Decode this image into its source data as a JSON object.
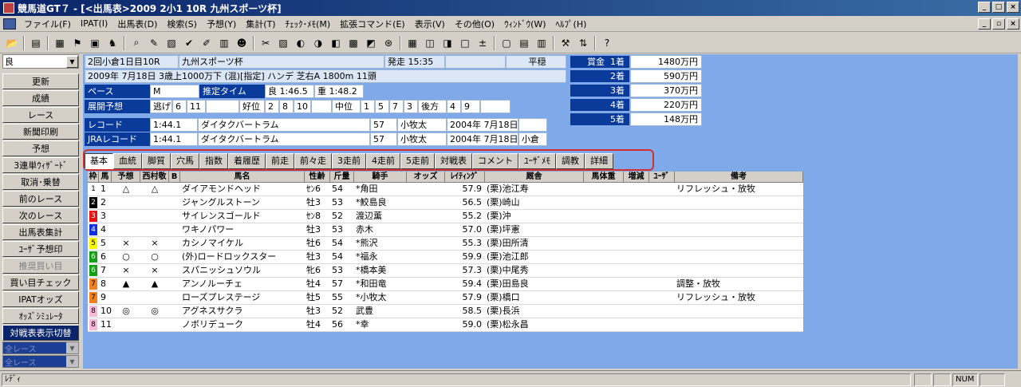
{
  "title": "競馬道GT７ - [<出馬表>2009 2小1 10R 九州スポーツ杯]",
  "menu": [
    "ファイル(F)",
    "IPAT(I)",
    "出馬表(D)",
    "検索(S)",
    "予想(Y)",
    "集計(T)",
    "ﾁｪｯｸ･ﾒﾓ(M)",
    "拡張コマンド(E)",
    "表示(V)",
    "その他(O)",
    "ｳｨﾝﾄﾞｳ(W)",
    "ﾍﾙﾌﾟ(H)"
  ],
  "toolbar_icons": [
    "open-icon",
    "print-icon",
    "list-icon",
    "flag-icon",
    "board-icon",
    "horse-icon",
    "search-icon",
    "edit-icon",
    "note-icon",
    "check-icon",
    "pencil-icon",
    "book-icon",
    "jockey-icon",
    "trainer-icon",
    "stats-icon",
    "graph-icon",
    "chart-icon",
    "map-icon",
    "table-icon",
    "memo-icon",
    "mark-icon",
    "grid-icon",
    "window-icon",
    "window2-icon",
    "window3-icon",
    "plus-icon",
    "sheet-icon",
    "doc-icon",
    "doc2-icon",
    "tool-icon",
    "sort-icon",
    "help-icon"
  ],
  "sidebar": {
    "condition": "良",
    "buttons": [
      "更新",
      "成績",
      "レース",
      "新聞印刷",
      "予想",
      "3連単ｳｨｻﾞｰﾄﾞ",
      "取消･乗替",
      "前のレース",
      "次のレース",
      "出馬表集計",
      "ﾕｰｻﾞ予想印",
      "推奨買い目",
      "買い目チェック",
      "IPATオッズ",
      "ｵｯｽﾞｼﾐｭﾚｰﾀ",
      "対戦表表示切替"
    ],
    "combo1": "全レース",
    "combo2": "全レース"
  },
  "race": {
    "meet": "2回小倉1日目10R",
    "name": "九州スポーツ杯",
    "post_label": "発走",
    "post_time": "15:35",
    "weather": "平穏",
    "detail": "2009年 7月18日 3歳上1000万下 (混)[指定] ハンデ 芝右A 1800m 11頭",
    "pace_label": "ペース",
    "pace": "M",
    "est_label": "推定タイム",
    "est1": "良 1:46.5",
    "est2": "重 1:48.2",
    "tenkai_label": "展開予想",
    "nige_label": "逃げ",
    "nige": [
      "6",
      "11"
    ],
    "kouI_label": "好位",
    "kouI": [
      "2",
      "8",
      "10"
    ],
    "chui_label": "中位",
    "chui": [
      "1",
      "5",
      "7",
      "3"
    ],
    "ushiro_label": "後方",
    "ushiro": [
      "4",
      "9"
    ],
    "record_label": "レコード",
    "record_time": "1:44.1",
    "record_horse": "ダイタクバートラム",
    "record_wt": "57",
    "record_jockey": "小牧太",
    "record_date": "2004年 7月18日",
    "jra_label": "JRAレコード",
    "jra_time": "1:44.1",
    "jra_horse": "ダイタクバートラム",
    "jra_wt": "57",
    "jra_jockey": "小牧太",
    "jra_date": "2004年 7月18日",
    "jra_place": "小倉"
  },
  "prize": {
    "label_prefix": "賞金",
    "rows": [
      {
        "rank": "1着",
        "amount": "1480万円"
      },
      {
        "rank": "2着",
        "amount": "590万円"
      },
      {
        "rank": "3着",
        "amount": "370万円"
      },
      {
        "rank": "4着",
        "amount": "220万円"
      },
      {
        "rank": "5着",
        "amount": "148万円"
      }
    ]
  },
  "tabs": [
    "基本",
    "血統",
    "脚質",
    "穴馬",
    "指数",
    "着履歴",
    "前走",
    "前々走",
    "3走前",
    "4走前",
    "5走前",
    "対戦表",
    "コメント",
    "ﾕｰｻﾞﾒﾓ",
    "調教",
    "詳細"
  ],
  "columns": [
    "枠",
    "馬",
    "予想",
    "西村敬",
    "B",
    "馬名",
    "性齢",
    "斤量",
    "騎手",
    "オッズ",
    "ﾚｲﾃｨﾝｸﾞ",
    "厩舎",
    "馬体重",
    "増減",
    "ﾕｰｻﾞ",
    "備考"
  ],
  "colors": {
    "w1": "#ffffff",
    "w2": "#000000",
    "w3": "#e81010",
    "w4": "#1030e0",
    "w5": "#f8f800",
    "w6": "#10a010",
    "w7": "#f08020",
    "w8": "#f8b8d8"
  },
  "horses": [
    {
      "waku": "1",
      "num": "1",
      "yoso": "△",
      "nishi": "△",
      "name": "ダイアモンドヘッド",
      "sexage": "ｾﾝ6",
      "wt": "54",
      "jockey": "*角田",
      "rating": "57.9",
      "stable": "(栗)池江寿",
      "note": "リフレッシュ・放牧"
    },
    {
      "waku": "2",
      "num": "2",
      "yoso": "",
      "nishi": "",
      "name": "ジャングルストーン",
      "sexage": "牡3",
      "wt": "53",
      "jockey": "*鮫島良",
      "rating": "56.5",
      "stable": "(栗)崎山",
      "note": ""
    },
    {
      "waku": "3",
      "num": "3",
      "yoso": "",
      "nishi": "",
      "name": "サイレンスゴールド",
      "sexage": "ｾﾝ8",
      "wt": "52",
      "jockey": "渡辺薫",
      "rating": "55.2",
      "stable": "(栗)沖",
      "note": ""
    },
    {
      "waku": "4",
      "num": "4",
      "yoso": "",
      "nishi": "",
      "name": "ワキノパワー",
      "sexage": "牡3",
      "wt": "53",
      "jockey": "赤木",
      "rating": "57.0",
      "stable": "(栗)坪憲",
      "note": ""
    },
    {
      "waku": "5",
      "num": "5",
      "yoso": "×",
      "nishi": "×",
      "name": "カシノマイケル",
      "sexage": "牡6",
      "wt": "54",
      "jockey": "*熊沢",
      "rating": "55.3",
      "stable": "(栗)田所清",
      "note": ""
    },
    {
      "waku": "6",
      "num": "6",
      "yoso": "○",
      "nishi": "○",
      "name": "(外)ロードロックスター",
      "sexage": "牡3",
      "wt": "54",
      "jockey": "*福永",
      "rating": "59.9",
      "stable": "(栗)池江郎",
      "note": ""
    },
    {
      "waku": "6",
      "num": "7",
      "yoso": "×",
      "nishi": "×",
      "name": "スパニッシュソウル",
      "sexage": "牝6",
      "wt": "53",
      "jockey": "*橋本美",
      "rating": "57.3",
      "stable": "(栗)中尾秀",
      "note": ""
    },
    {
      "waku": "7",
      "num": "8",
      "yoso": "▲",
      "nishi": "▲",
      "name": "アンノルーチェ",
      "sexage": "牡4",
      "wt": "57",
      "jockey": "*和田竜",
      "rating": "59.4",
      "stable": "(栗)田島良",
      "note": "調整・放牧"
    },
    {
      "waku": "7",
      "num": "9",
      "yoso": "",
      "nishi": "",
      "name": "ローズプレステージ",
      "sexage": "牡5",
      "wt": "55",
      "jockey": "*小牧太",
      "rating": "57.9",
      "stable": "(栗)橋口",
      "note": "リフレッシュ・放牧"
    },
    {
      "waku": "8",
      "num": "10",
      "yoso": "◎",
      "nishi": "◎",
      "name": "アグネスサクラ",
      "sexage": "牡3",
      "wt": "52",
      "jockey": "武豊",
      "rating": "58.5",
      "stable": "(栗)長浜",
      "note": ""
    },
    {
      "waku": "8",
      "num": "11",
      "yoso": "",
      "nishi": "",
      "name": "ノボリデューク",
      "sexage": "牡4",
      "wt": "56",
      "jockey": "*幸",
      "rating": "59.0",
      "stable": "(栗)松永昌",
      "note": ""
    }
  ],
  "status": {
    "text": "ﾚﾃﾞｨ",
    "num": "NUM"
  }
}
